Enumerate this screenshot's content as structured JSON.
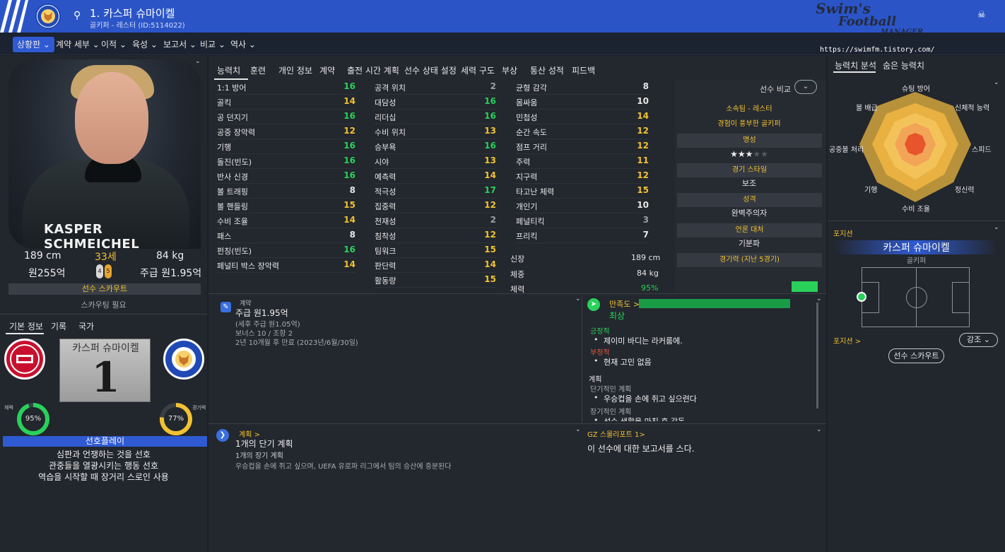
{
  "header": {
    "title": "1. 카스퍼 슈마이켈",
    "subtitle": "골키퍼 - 레스터 (ID:5114022)",
    "brand_line1": "Swim's",
    "brand_line2": "Football",
    "brand_line3": "MANAGER"
  },
  "url_overlay": "https://swimfm.tistory.com/",
  "nav": {
    "items": [
      "상황판 ⌄",
      "계약 세부 ⌄",
      "이적 ⌄",
      "육성 ⌄",
      "보고서 ⌄",
      "비교 ⌄",
      "역사 ⌄"
    ]
  },
  "profile": {
    "name_plate": "KASPER SCHMEICHEL",
    "height": "189 cm",
    "age": "33세",
    "weight": "84 kg",
    "value": "원255억",
    "wage": "주급 원1.95억",
    "foot_left": "4",
    "foot_right": "5",
    "scout_label": "선수 스카우트",
    "scout_note": "스카우팅 필요"
  },
  "left_tabs": [
    "기본 정보",
    "기록",
    "국가"
  ],
  "kit": {
    "name": "카스퍼 슈마이켈",
    "number": "1"
  },
  "rings": {
    "fitness_label": "체력",
    "fitness_value": "95%",
    "fitness_pct": 95,
    "match_label": "경기력",
    "match_value": "77%",
    "match_pct": 77
  },
  "preferences": {
    "title": "선호플레이",
    "lines": [
      "심판과 언쟁하는 것을 선호",
      "관중들을 열광시키는 행동 선호",
      "역습을 시작할 때 장거리 스로인 사용"
    ]
  },
  "center_tabs": [
    "능력치",
    "훈련",
    "개인 정보",
    "계약",
    "출전 시간 계획",
    "선수 상태 설정",
    "세력 구도",
    "부상",
    "통산 성적",
    "피드백"
  ],
  "attributes": {
    "col1": [
      {
        "label": "1:1 방어",
        "value": "16",
        "c": "g"
      },
      {
        "label": "골킥",
        "value": "14",
        "c": "y"
      },
      {
        "label": "공 던지기",
        "value": "16",
        "c": "g"
      },
      {
        "label": "공중 장악력",
        "value": "12",
        "c": "y"
      },
      {
        "label": "기행",
        "value": "16",
        "c": "g"
      },
      {
        "label": "돌진(빈도)",
        "value": "16",
        "c": "g"
      },
      {
        "label": "반사 신경",
        "value": "16",
        "c": "g"
      },
      {
        "label": "볼 트래핑",
        "value": "8",
        "c": "w"
      },
      {
        "label": "볼 핸들링",
        "value": "15",
        "c": "y"
      },
      {
        "label": "수비 조율",
        "value": "14",
        "c": "y"
      },
      {
        "label": "패스",
        "value": "8",
        "c": "w"
      },
      {
        "label": "펀칭(빈도)",
        "value": "16",
        "c": "g"
      },
      {
        "label": "페널티 박스 장악력",
        "value": "14",
        "c": "y"
      }
    ],
    "col2": [
      {
        "label": "공격 위치",
        "value": "2",
        "c": "s"
      },
      {
        "label": "대담성",
        "value": "16",
        "c": "g"
      },
      {
        "label": "리더십",
        "value": "16",
        "c": "g"
      },
      {
        "label": "수비 위치",
        "value": "13",
        "c": "y"
      },
      {
        "label": "승부욕",
        "value": "16",
        "c": "g"
      },
      {
        "label": "시야",
        "value": "13",
        "c": "y"
      },
      {
        "label": "예측력",
        "value": "14",
        "c": "y"
      },
      {
        "label": "적극성",
        "value": "17",
        "c": "g"
      },
      {
        "label": "집중력",
        "value": "12",
        "c": "y"
      },
      {
        "label": "천재성",
        "value": "2",
        "c": "s"
      },
      {
        "label": "침착성",
        "value": "12",
        "c": "y"
      },
      {
        "label": "팀워크",
        "value": "15",
        "c": "y"
      },
      {
        "label": "판단력",
        "value": "14",
        "c": "y"
      },
      {
        "label": "활동량",
        "value": "15",
        "c": "y"
      }
    ],
    "col3": [
      {
        "label": "균형 감각",
        "value": "8",
        "c": "w"
      },
      {
        "label": "몸싸움",
        "value": "10",
        "c": "w"
      },
      {
        "label": "민첩성",
        "value": "14",
        "c": "y"
      },
      {
        "label": "순간 속도",
        "value": "12",
        "c": "y"
      },
      {
        "label": "점프 거리",
        "value": "12",
        "c": "y"
      },
      {
        "label": "주력",
        "value": "11",
        "c": "y"
      },
      {
        "label": "지구력",
        "value": "12",
        "c": "y"
      },
      {
        "label": "타고난 체력",
        "value": "15",
        "c": "y"
      },
      {
        "label": "개인기",
        "value": "10",
        "c": "w"
      },
      {
        "label": "페널티킥",
        "value": "3",
        "c": "s"
      },
      {
        "label": "프리킥",
        "value": "7",
        "c": "w"
      }
    ]
  },
  "physical": {
    "height_label": "신장",
    "height_value": "189 cm",
    "weight_label": "체중",
    "weight_value": "84 kg",
    "fitness_label": "체력",
    "fitness_value": "95%"
  },
  "side_info": {
    "compare_label": "선수 비교",
    "club_title": "소속팀 - 레스터",
    "club_desc": "경험이 풍부한 골키퍼",
    "reputation_head": "명성",
    "reputation_stars": "★★★★★",
    "style_head": "경기 스타일",
    "style_value": "보조",
    "personality_head": "성격",
    "personality_value": "완벽주의자",
    "media_head": "언론 대처",
    "media_value": "기분파",
    "form_head": "경기력 (지난 5경기)"
  },
  "contract": {
    "heading": "계약",
    "wage": "주급 원1.95억",
    "after_tax": "(세후 주급 원1.05억)",
    "bonus": "보너스 10 / 조항 2",
    "expiry": "2년 10개월 후 만료 (2023년/6월/30일)"
  },
  "satisfaction": {
    "heading": "만족도 >",
    "level": "최상",
    "positive_head": "긍정적",
    "positive": "제이미 바디는 라커룸에.",
    "negative_head": "부정적",
    "negative": "현재 고민 없음",
    "plan_head": "계획",
    "short_head": "단기적인 계획",
    "short": "우승컵을 손에 쥐고 싶으련다",
    "long_head": "장기적인 계획",
    "long": "선수 생활을 마친 후 감독"
  },
  "plans": {
    "heading": "계획 >",
    "short_count": "1개의 단기 계획",
    "long_count": "1개의 장기 계획",
    "desc": "우승컵을 손에 쥐고 싶으며, UEFA 유로파 리그에서 팀의 승산에 중분된다"
  },
  "report": {
    "heading": "GZ 스몰리포트 1>",
    "text": "이 선수에 대한 보고서를 스다."
  },
  "right": {
    "tabs": [
      "능력치 분석",
      "숨은 능력치"
    ],
    "radar_labels": [
      "슈팅 방어",
      "신체적 능력",
      "스피드",
      "정신력",
      "수비 조율",
      "기행",
      "공중볼 처리",
      "볼 배급"
    ],
    "position_head": "포지션",
    "player_name": "카스퍼 슈마이켈",
    "player_pos": "골키퍼",
    "position_link": "포지션 >",
    "strength_btn": "강조",
    "scout_btn": "선수 스카우트"
  },
  "colors": {
    "accent": "#2f5ad1",
    "good": "#29d15b",
    "medium": "#f1c232",
    "header": "#2b55c7"
  }
}
